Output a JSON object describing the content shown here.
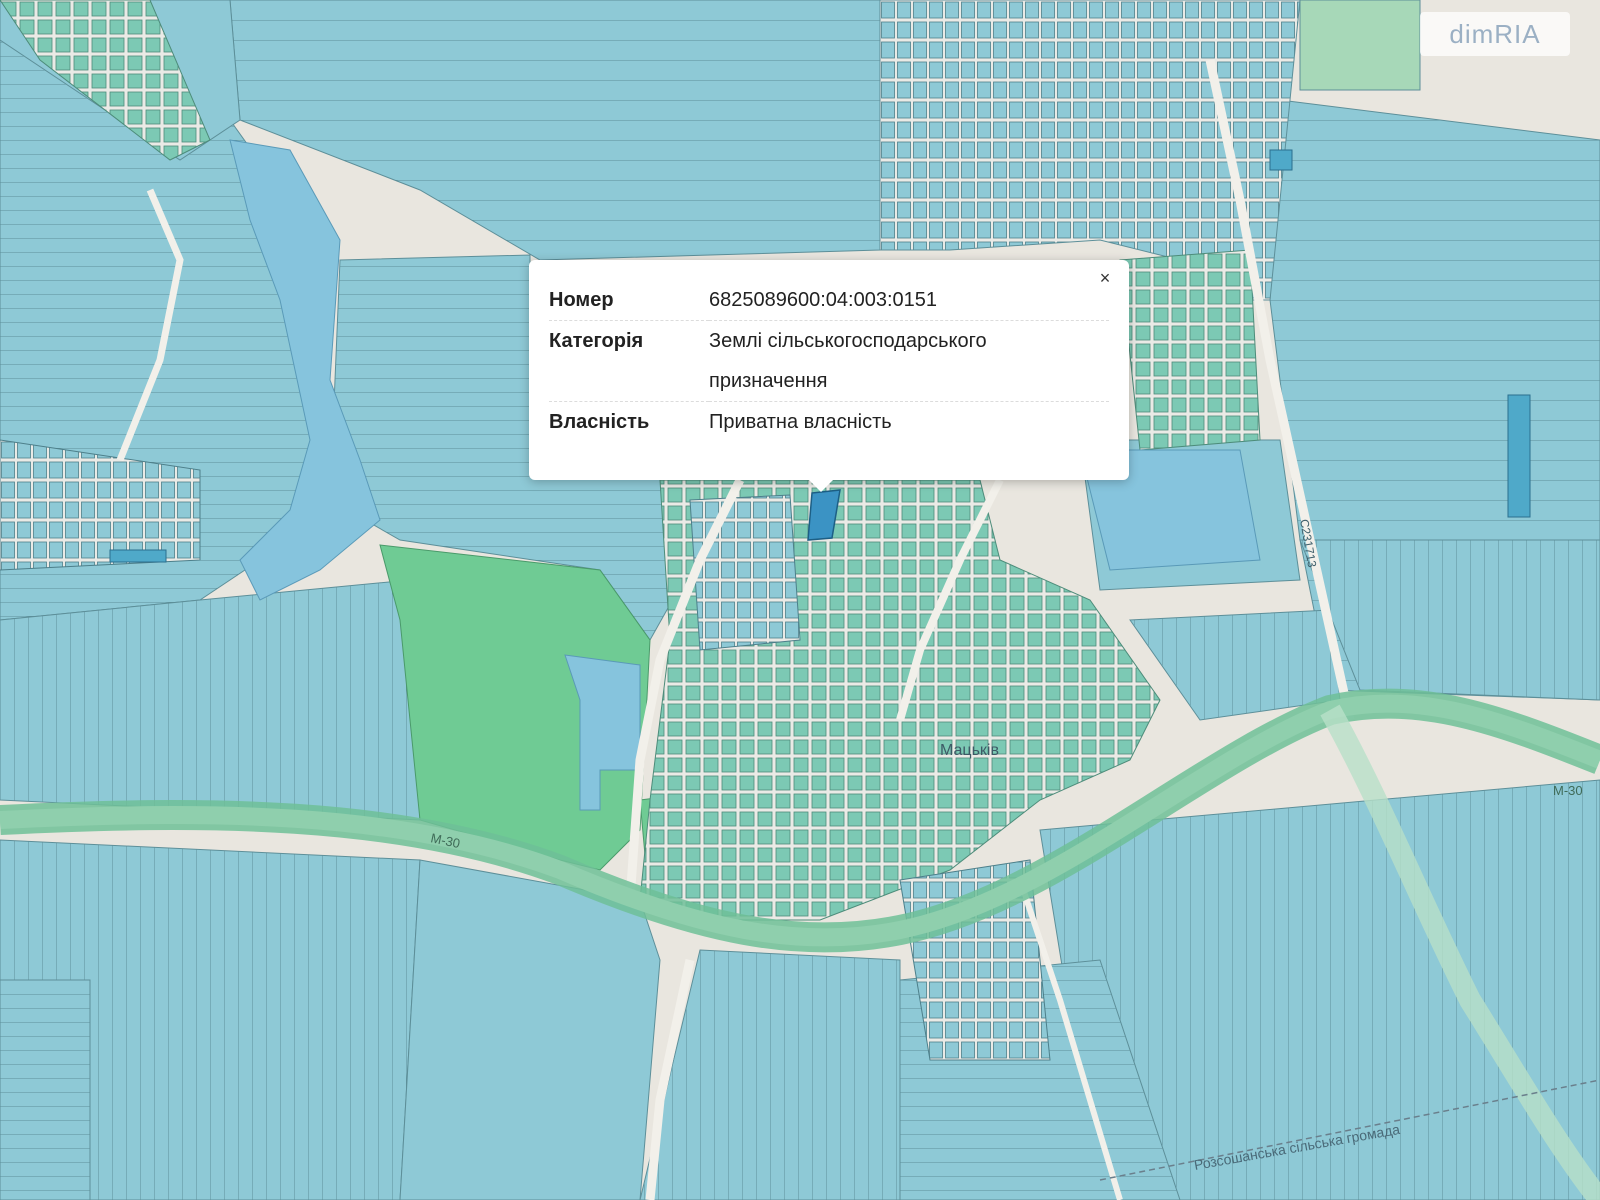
{
  "popup": {
    "rows": [
      {
        "key": "Номер",
        "value": "6825089600:04:003:0151"
      },
      {
        "key": "Категорія",
        "value": "Землі сільськогосподарського призначення"
      },
      {
        "key": "Власність",
        "value": "Приватна власність"
      }
    ],
    "close_label": "×"
  },
  "map_labels": {
    "road_m30_left": "М-30",
    "road_m30_right": "М-30",
    "road_c": "С231713",
    "village": "Мацьків",
    "community": "Розсошанська сільська громада"
  },
  "watermark": "dimRIA",
  "colors": {
    "parcel_blue": "#8ec9d6",
    "parcel_teal": "#7cc9b4",
    "parcel_dark": "#4fa9c9",
    "forest": "#6fcb94",
    "water": "#86c4dd",
    "road_highway": "#8fcfad",
    "background": "#e9e6df"
  }
}
